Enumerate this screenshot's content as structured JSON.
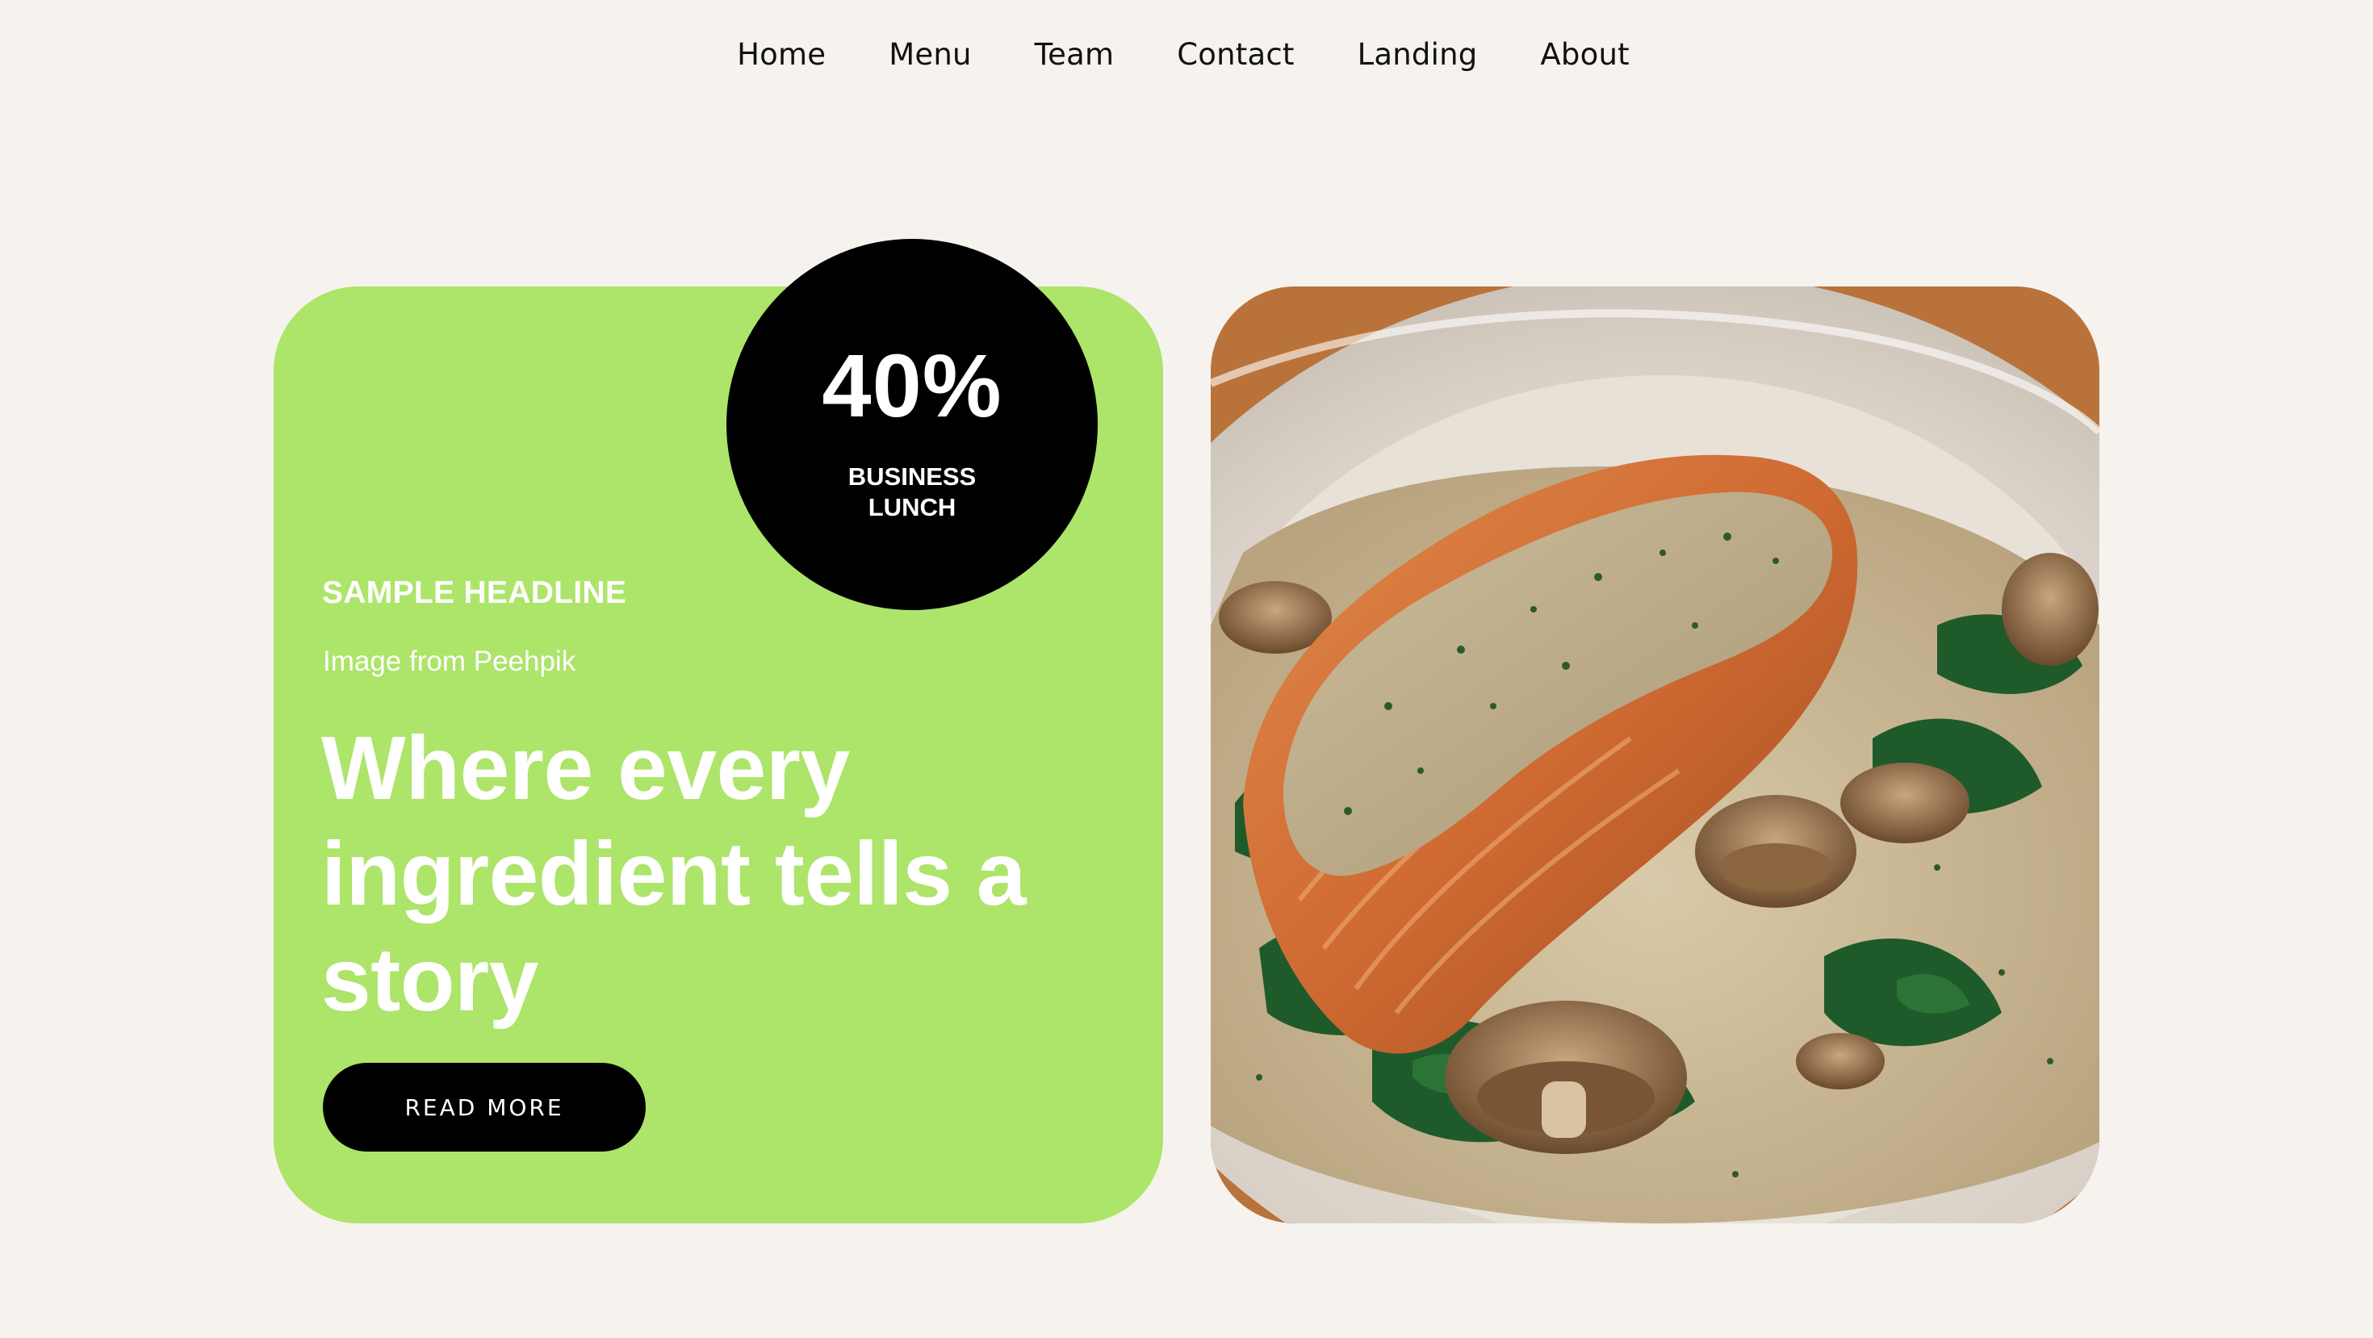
{
  "nav": {
    "items": [
      {
        "label": "Home"
      },
      {
        "label": "Menu"
      },
      {
        "label": "Team"
      },
      {
        "label": "Contact"
      },
      {
        "label": "Landing"
      },
      {
        "label": "About"
      }
    ]
  },
  "promo": {
    "badge": {
      "value": "40%",
      "label": "BUSINESS LUNCH"
    },
    "eyebrow": "SAMPLE HEADLINE",
    "credit": "Image from Peehpik",
    "headline": "Where every ingredient tells a story",
    "cta_label": "READ MORE"
  },
  "colors": {
    "background": "#f6f3ee",
    "card_green": "#ade46a",
    "badge": "#000000",
    "button": "#000000"
  },
  "photo": {
    "icon": "salmon-dish-photo"
  }
}
